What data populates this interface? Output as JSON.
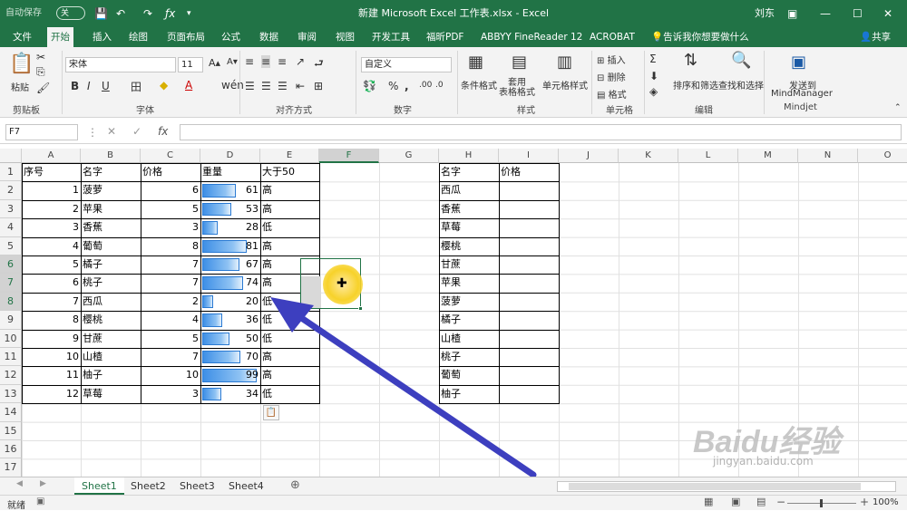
{
  "title": {
    "autosave": "自动保存",
    "off": "关",
    "doc": "新建 Microsoft Excel 工作表.xlsx  -  Excel",
    "user": "刘东"
  },
  "tabs": [
    "文件",
    "开始",
    "插入",
    "绘图",
    "页面布局",
    "公式",
    "数据",
    "审阅",
    "视图",
    "开发工具",
    "福昕PDF",
    "ABBYY FineReader 12",
    "ACROBAT",
    "告诉我你想要做什么"
  ],
  "share": "共享",
  "ribbon": {
    "paste": "粘贴",
    "font_name": "宋体",
    "font_size": "11",
    "number_format": "自定义",
    "cond_format": "条件格式",
    "table_format": "套用\n表格格式",
    "cell_style": "单元格样式",
    "insert": "插入",
    "delete": "删除",
    "format": "格式",
    "sort_filter": "排序和筛选",
    "find_select": "查找和选择",
    "send_to": "发送到",
    "mindmanager": "MindManager",
    "groups": [
      "剪贴板",
      "字体",
      "对齐方式",
      "数字",
      "样式",
      "单元格",
      "编辑",
      "Mindjet"
    ]
  },
  "formula_bar": {
    "name_box": "F7",
    "formula": "",
    "fx": "fx"
  },
  "columns": [
    "A",
    "B",
    "C",
    "D",
    "E",
    "F",
    "G",
    "H",
    "I",
    "J",
    "K",
    "L",
    "M",
    "N",
    "O"
  ],
  "rows": [
    "1",
    "2",
    "3",
    "4",
    "5",
    "6",
    "7",
    "8",
    "9",
    "10",
    "11",
    "12",
    "13",
    "14",
    "15",
    "16",
    "17"
  ],
  "table_left": {
    "headers": [
      "序号",
      "名字",
      "价格",
      "重量",
      "大于50"
    ],
    "rows": [
      [
        "1",
        "菠萝",
        "6",
        "61",
        "高"
      ],
      [
        "2",
        "苹果",
        "5",
        "53",
        "高"
      ],
      [
        "3",
        "香蕉",
        "3",
        "28",
        "低"
      ],
      [
        "4",
        "葡萄",
        "8",
        "81",
        "高"
      ],
      [
        "5",
        "橘子",
        "7",
        "67",
        "高"
      ],
      [
        "6",
        "桃子",
        "7",
        "74",
        "高"
      ],
      [
        "7",
        "西瓜",
        "2",
        "20",
        "低"
      ],
      [
        "8",
        "樱桃",
        "4",
        "36",
        "低"
      ],
      [
        "9",
        "甘蔗",
        "5",
        "50",
        "低"
      ],
      [
        "10",
        "山楂",
        "7",
        "70",
        "高"
      ],
      [
        "11",
        "柚子",
        "10",
        "99",
        "高"
      ],
      [
        "12",
        "草莓",
        "3",
        "34",
        "低"
      ]
    ],
    "bar_values": [
      61,
      53,
      28,
      81,
      67,
      74,
      20,
      36,
      50,
      70,
      99,
      34
    ],
    "bar_max": 99
  },
  "table_right": {
    "headers": [
      "名字",
      "价格"
    ],
    "names": [
      "西瓜",
      "香蕉",
      "草莓",
      "樱桃",
      "甘蔗",
      "苹果",
      "菠萝",
      "橘子",
      "山楂",
      "桃子",
      "葡萄",
      "柚子"
    ]
  },
  "sheets": [
    "Sheet1",
    "Sheet2",
    "Sheet3",
    "Sheet4"
  ],
  "status": {
    "ready": "就绪",
    "zoom": "100%"
  },
  "watermark": "Baidu经验",
  "watermark_url": "jingyan.baidu.com",
  "colors": {
    "excel_green": "#217346",
    "arrow": "#3d3fbf",
    "highlight": "#f5d800",
    "bar": "#3e8fe6"
  }
}
